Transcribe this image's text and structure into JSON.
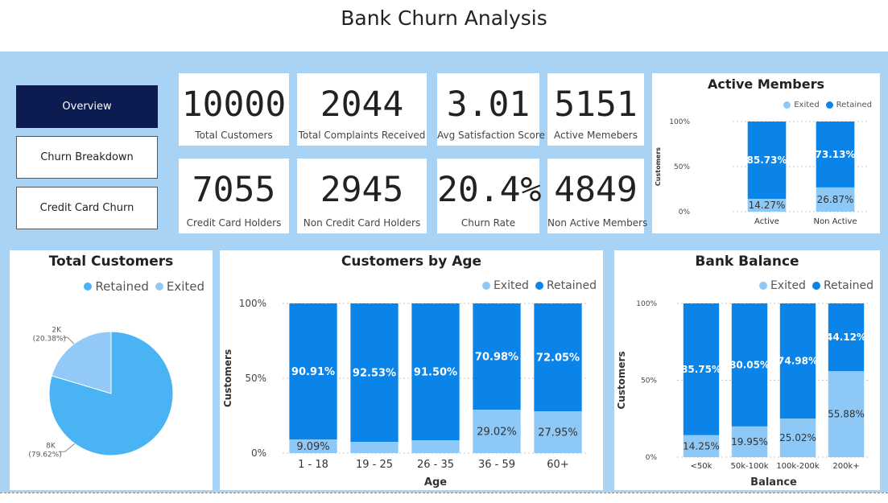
{
  "header": {
    "title": "Bank Churn Analysis"
  },
  "nav": [
    {
      "label": "Overview",
      "active": true
    },
    {
      "label": "Churn Breakdown",
      "active": false
    },
    {
      "label": "Credit Card Churn",
      "active": false
    }
  ],
  "kpis": [
    {
      "value": "10000",
      "label": "Total Customers"
    },
    {
      "value": "2044",
      "label": "Total Complaints Received"
    },
    {
      "value": "3.01",
      "label": "Avg Satisfaction Score"
    },
    {
      "value": "5151",
      "label": "Active Memebers"
    },
    {
      "value": "7055",
      "label": "Credit Card Holders"
    },
    {
      "value": "2945",
      "label": "Non Credit Card Holders"
    },
    {
      "value": "20.4%",
      "label": "Churn Rate"
    },
    {
      "value": "4849",
      "label": "Non Active Members"
    }
  ],
  "colors": {
    "retained": "#0a84e8",
    "exited": "#8ec8f6",
    "pie_retained": "#4ab3f3",
    "pie_exited": "#93c9f6"
  },
  "chart_data": [
    {
      "id": "active_members",
      "type": "bar",
      "title": "Active Members",
      "legend": [
        "Exited",
        "Retained"
      ],
      "ylabel": "Customers",
      "yticks": [
        "100%",
        "50%",
        "0%"
      ],
      "categories": [
        "Active",
        "Non Active"
      ],
      "series": [
        {
          "name": "Exited",
          "values": [
            14.27,
            26.87
          ],
          "labels": [
            "14.27%",
            "26.87%"
          ]
        },
        {
          "name": "Retained",
          "values": [
            85.73,
            73.13
          ],
          "labels": [
            "85.73%",
            "73.13%"
          ]
        }
      ]
    },
    {
      "id": "total_customers",
      "type": "pie",
      "title": "Total Customers",
      "legend": [
        "Retained",
        "Exited"
      ],
      "slices": [
        {
          "name": "Retained",
          "value": 79.62,
          "label": "8K",
          "pct": "(79.62%)"
        },
        {
          "name": "Exited",
          "value": 20.38,
          "label": "2K",
          "pct": "(20.38%)"
        }
      ]
    },
    {
      "id": "customers_by_age",
      "type": "bar",
      "title": "Customers by Age",
      "legend": [
        "Exited",
        "Retained"
      ],
      "xlabel": "Age",
      "ylabel": "Customers",
      "yticks": [
        "100%",
        "50%",
        "0%"
      ],
      "categories": [
        "1 - 18",
        "19 - 25",
        "26 - 35",
        "36 - 59",
        "60+"
      ],
      "series": [
        {
          "name": "Exited",
          "values": [
            9.09,
            7.47,
            8.5,
            29.02,
            27.95
          ],
          "labels": [
            "9.09%",
            "",
            "",
            "29.02%",
            "27.95%"
          ]
        },
        {
          "name": "Retained",
          "values": [
            90.91,
            92.53,
            91.5,
            70.98,
            72.05
          ],
          "labels": [
            "90.91%",
            "92.53%",
            "91.50%",
            "70.98%",
            "72.05%"
          ]
        }
      ]
    },
    {
      "id": "bank_balance",
      "type": "bar",
      "title": "Bank Balance",
      "legend": [
        "Exited",
        "Retained"
      ],
      "xlabel": "Balance",
      "ylabel": "Customers",
      "yticks": [
        "100%",
        "50%",
        "0%"
      ],
      "categories": [
        "<50k",
        "50k-100k",
        "100k-200k",
        "200k+"
      ],
      "series": [
        {
          "name": "Exited",
          "values": [
            14.25,
            19.95,
            25.02,
            55.88
          ],
          "labels": [
            "14.25%",
            "19.95%",
            "25.02%",
            "55.88%"
          ]
        },
        {
          "name": "Retained",
          "values": [
            85.75,
            80.05,
            74.98,
            44.12
          ],
          "labels": [
            "85.75%",
            "80.05%",
            "74.98%",
            "44.12%"
          ]
        }
      ]
    }
  ]
}
